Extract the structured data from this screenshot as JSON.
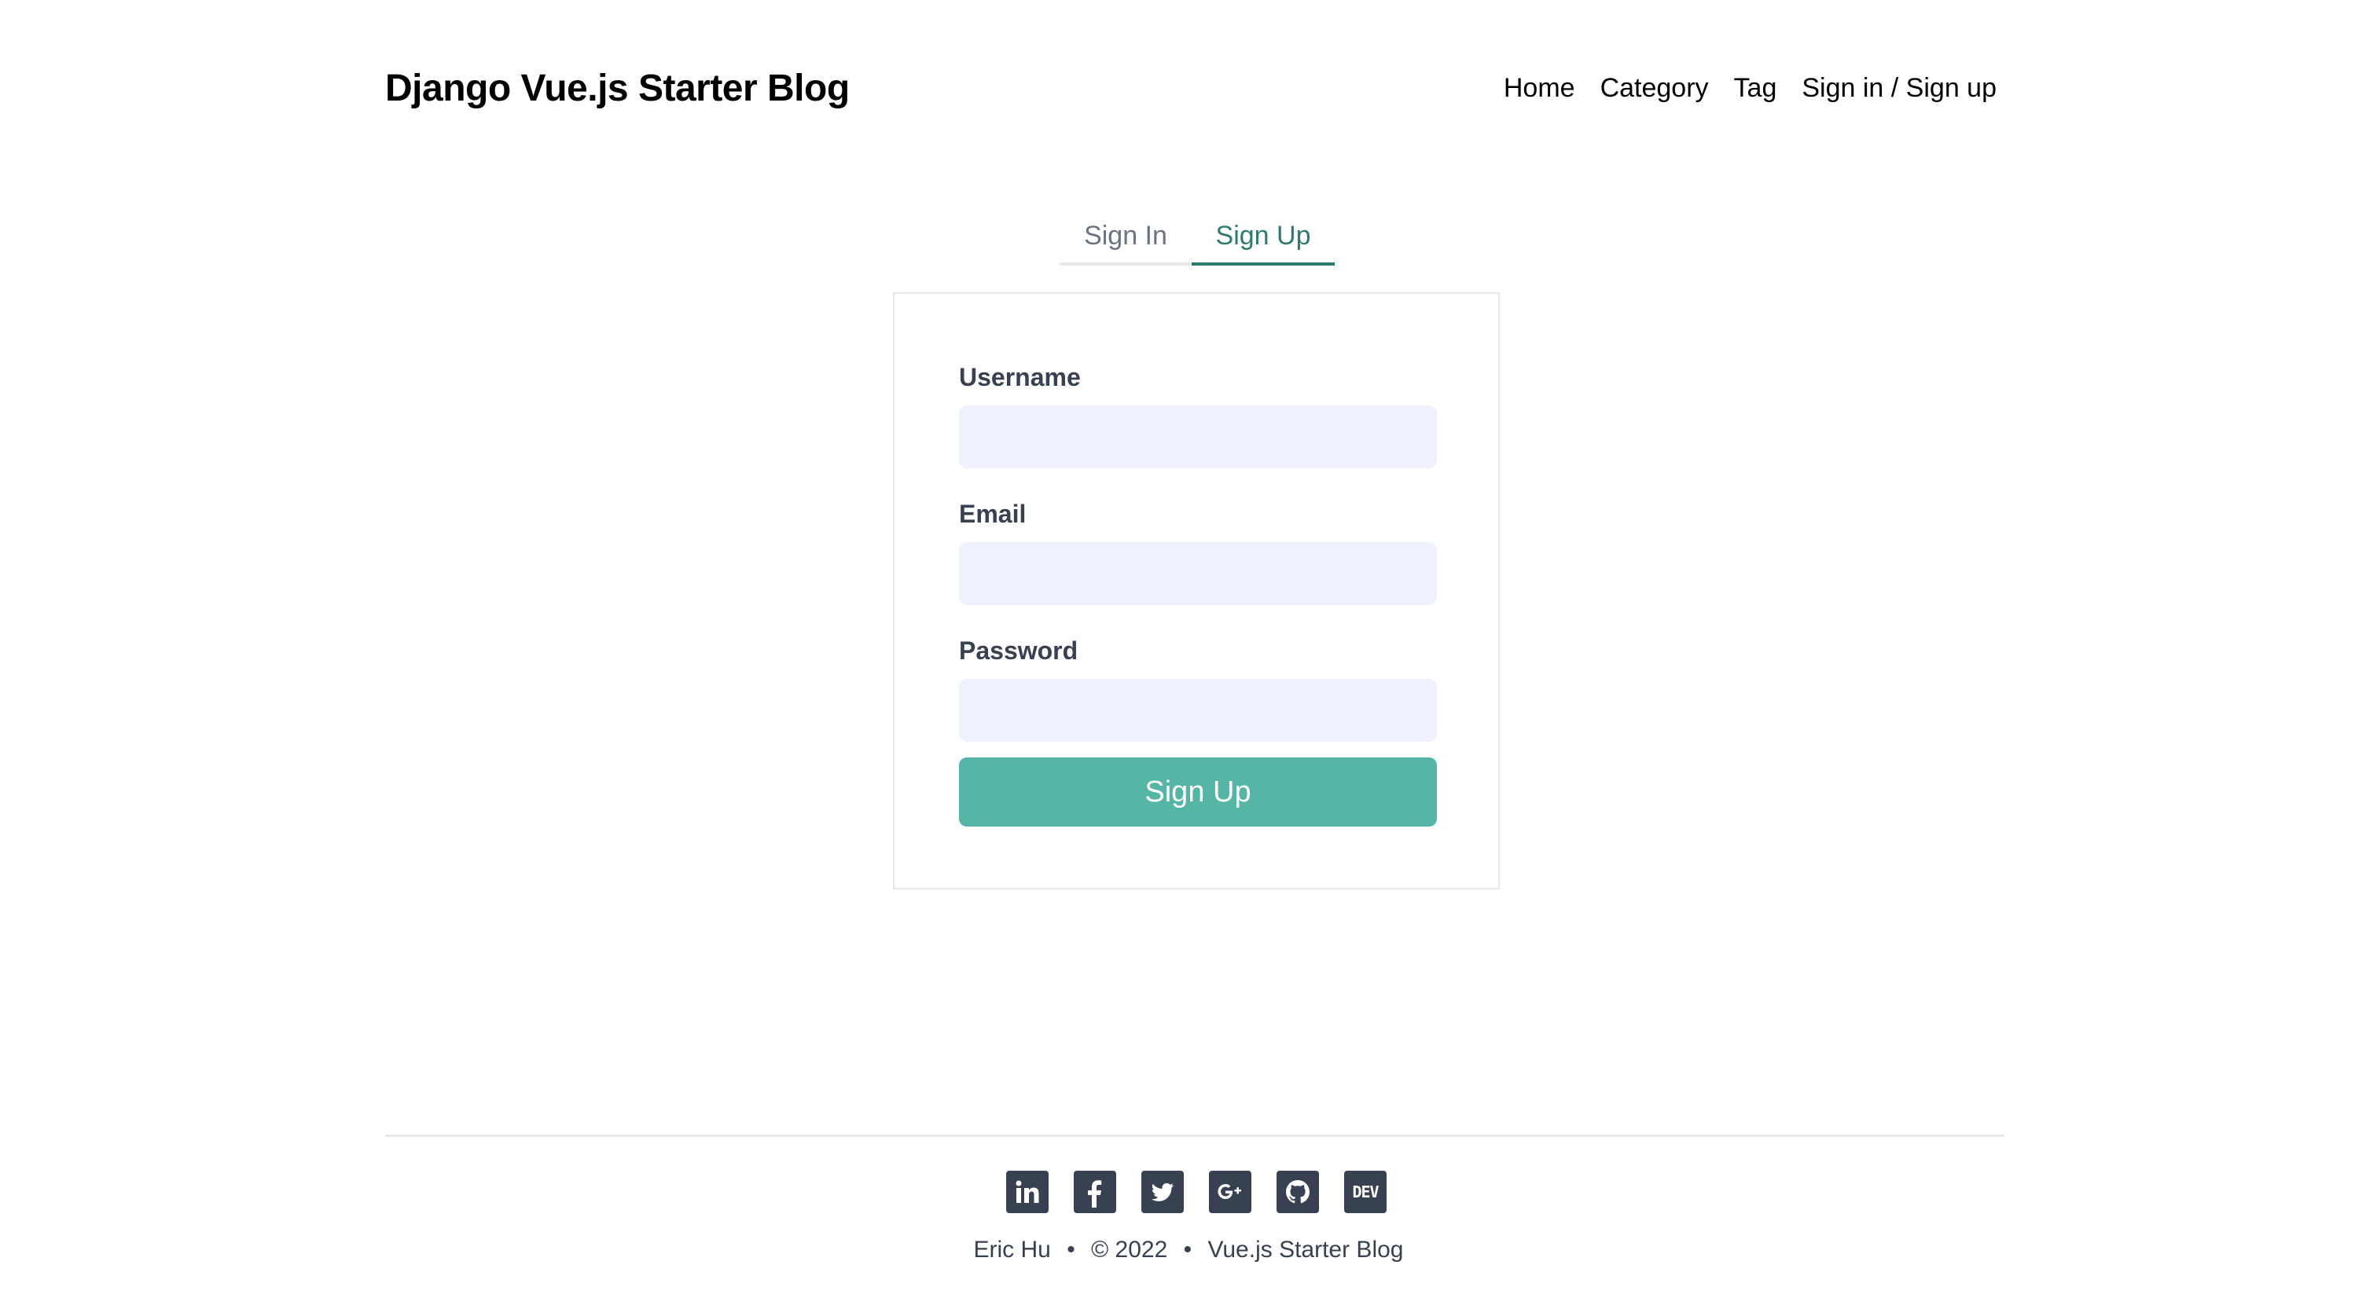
{
  "header": {
    "site_title": "Django Vue.js Starter Blog",
    "nav": {
      "home": "Home",
      "category": "Category",
      "tag": "Tag",
      "auth": "Sign in / Sign up"
    }
  },
  "auth_tabs": {
    "sign_in": "Sign In",
    "sign_up": "Sign Up",
    "active": "Sign Up"
  },
  "form": {
    "username_label": "Username",
    "username_value": "",
    "email_label": "Email",
    "email_value": "",
    "password_label": "Password",
    "password_value": "",
    "submit_label": "Sign Up"
  },
  "footer": {
    "social_icons": [
      "linkedin-icon",
      "facebook-icon",
      "twitter-icon",
      "google-plus-icon",
      "github-icon",
      "dev-icon"
    ],
    "dev_label": "DEV",
    "author": "Eric Hu",
    "separator": "•",
    "copyright": "© 2022",
    "site_name": "Vue.js Starter Blog"
  },
  "colors": {
    "accent": "#2f7a6f",
    "button": "#55b6a6",
    "input_bg": "#eff2fd",
    "icon": "#374151"
  }
}
